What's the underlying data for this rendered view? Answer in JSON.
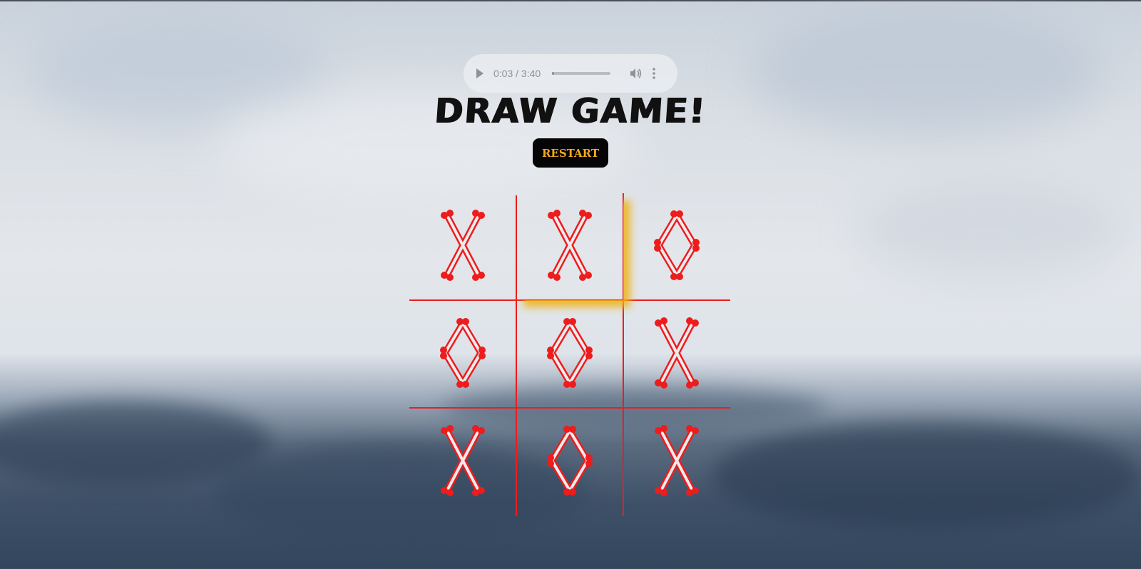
{
  "audio": {
    "current_time": "0:03",
    "duration": "3:40",
    "time_display": "0:03 / 3:40",
    "progress": 0.035
  },
  "status": {
    "message": "DRAW GAME!"
  },
  "controls": {
    "restart_label": "RESTART"
  },
  "board": {
    "cells": [
      "X",
      "X",
      "O",
      "O",
      "O",
      "X",
      "X",
      "O",
      "X"
    ],
    "highlighted_cell": 1
  },
  "colors": {
    "mark": "#ee1c1c",
    "grid": "#ee1c1c",
    "highlight": "#f0b214",
    "button_bg": "#050505",
    "button_text": "#f0a922"
  },
  "icons": {
    "play": "play-icon",
    "volume": "volume-icon",
    "more": "more-options-icon"
  }
}
